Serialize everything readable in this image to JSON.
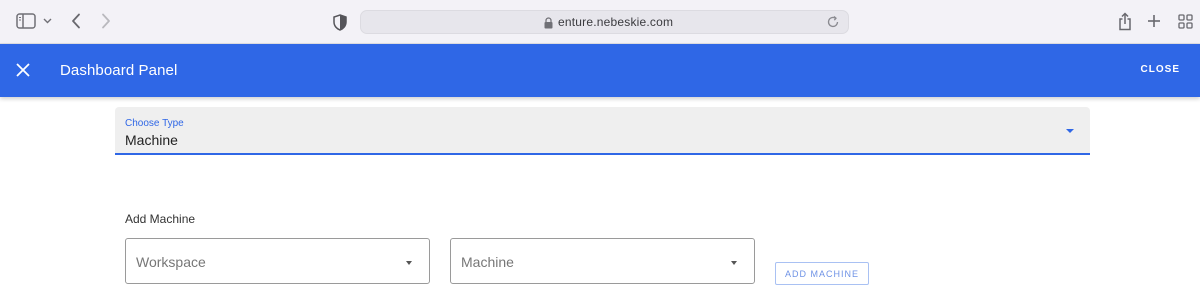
{
  "browser": {
    "url": "enture.nebeskie.com",
    "icons": {
      "sidebar": "sidebar-icon",
      "chevron": "chevron-down-icon",
      "back": "chevron-left-icon",
      "forward": "chevron-right-icon",
      "shield": "shield-icon",
      "lock": "lock-icon",
      "reload": "reload-icon",
      "share": "share-icon",
      "new_tab": "plus-icon",
      "tabs": "grid-icon"
    }
  },
  "header": {
    "title": "Dashboard Panel",
    "close_label": "CLOSE",
    "color": "#2f67e6"
  },
  "type_select": {
    "label": "Choose Type",
    "value": "Machine"
  },
  "add_section": {
    "title": "Add Machine",
    "workspace_placeholder": "Workspace",
    "machine_placeholder": "Machine",
    "add_button": "ADD MACHINE"
  }
}
